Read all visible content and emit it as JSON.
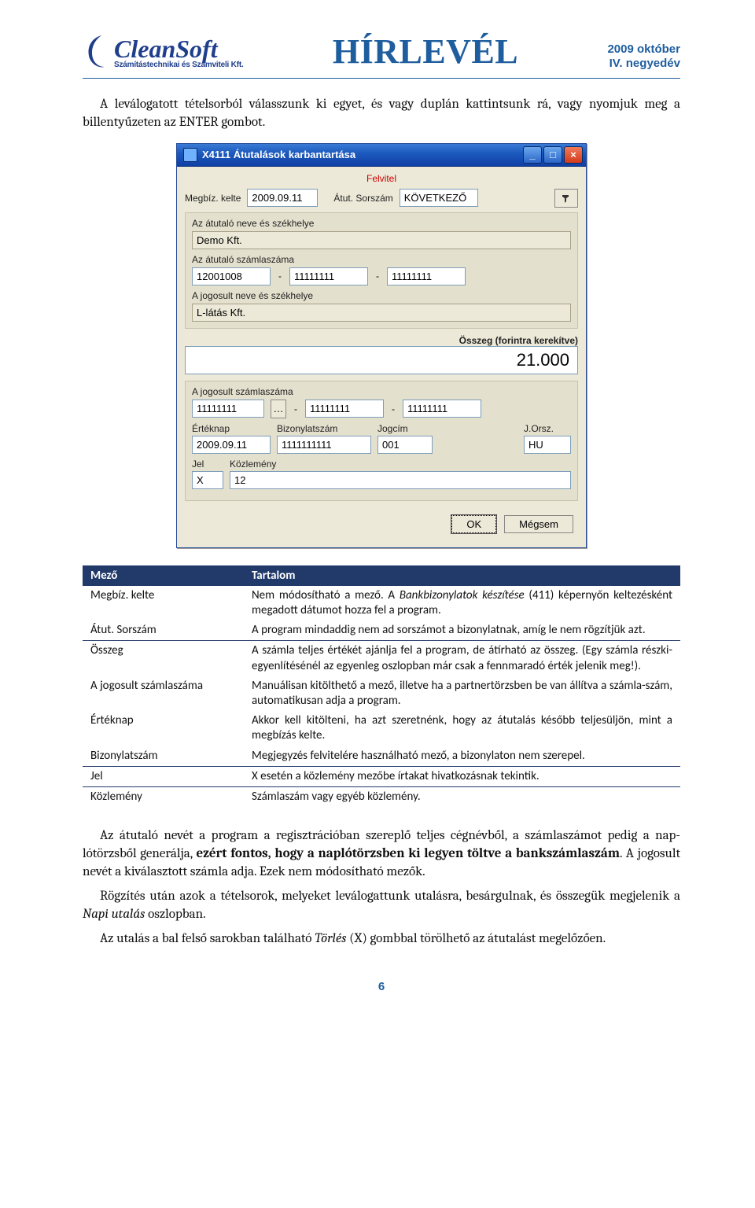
{
  "header": {
    "brand_name": "CleanSoft",
    "brand_sub": "Számítástechnikai és Számviteli Kft.",
    "banner": "HÍRLEVÉL",
    "issue_line1": "2009 október",
    "issue_line2": "IV. negyedév"
  },
  "intro": "A leválogatott tételsorból válasszunk ki egyet, és vagy duplán kattintsunk rá, vagy nyomjuk meg a billentyűzeten az ENTER gombot.",
  "window": {
    "title": "X4111 Átutalások karbantartása",
    "mode": "Felvitel",
    "labels": {
      "megbiz_kelte": "Megbíz. kelte",
      "atut_sorszam": "Átut. Sorszám",
      "atutalo_nev": "Az átutaló neve és székhelye",
      "atutalo_szamla": "Az átutaló számlaszáma",
      "jogosult_nev": "A jogosult neve és székhelye",
      "osszeg": "Összeg (forintra kerekítve)",
      "jogosult_szamla": "A jogosult számlaszáma",
      "erteknap": "Értéknap",
      "bizszam": "Bizonylatszám",
      "jogcim": "Jogcím",
      "jorsz": "J.Orsz.",
      "jel": "Jel",
      "kozlemeny": "Közlemény"
    },
    "values": {
      "megbiz_kelte": "2009.09.11",
      "sorszam": "KÖVETKEZŐ",
      "atutalo_nev": "Demo Kft.",
      "atutalo_szamla": [
        "12001008",
        "11111111",
        "11111111"
      ],
      "jogosult_nev": "L-látás Kft.",
      "osszeg": "21.000",
      "jogosult_szamla": [
        "11111111",
        "11111111",
        "11111111"
      ],
      "erteknap": "2009.09.11",
      "bizszam": "1111111111",
      "jogcim": "001",
      "jorsz": "HU",
      "jel": "X",
      "kozlemeny": "12"
    },
    "buttons": {
      "ok": "OK",
      "cancel": "Mégsem"
    }
  },
  "table": {
    "headers": [
      "Mező",
      "Tartalom"
    ],
    "rows": [
      {
        "field": "Megbíz. kelte",
        "content": "Nem módosítható a mező. A Bankbizonylatok készítése (411) képernyőn keltezésként megadott dátumot hozza fel a program.",
        "italic_span": "Bankbizonylatok készítése"
      },
      {
        "field": "Átut. Sorszám",
        "content": "A program mindaddig nem ad sorszámot a bizonylatnak, amíg le nem rögzítjük azt."
      },
      {
        "field": "Összeg",
        "content": "A számla teljes értékét ajánlja fel a program, de átírható az összeg. (Egy számla részki-egyenlítésénél az egyenleg oszlopban már csak a fennmaradó érték jelenik meg!).",
        "sep": true
      },
      {
        "field": "A jogosult számlaszáma",
        "content": "Manuálisan kitölthető a mező, illetve ha a partnertörzsben be van állítva a számla-szám, automatikusan adja a program."
      },
      {
        "field": "Értéknap",
        "content": "Akkor kell kitölteni, ha azt szeretnénk, hogy az átutalás később teljesüljön, mint a megbízás kelte."
      },
      {
        "field": "Bizonylatszám",
        "content": "Megjegyzés felvitelére használható mező, a bizonylaton nem szerepel."
      },
      {
        "field": "Jel",
        "content": "X esetén a közlemény mezőbe írtakat hivatkozásnak tekintik.",
        "sep": true
      },
      {
        "field": "Közlemény",
        "content": "Számlaszám vagy egyéb közlemény.",
        "sep": true
      }
    ]
  },
  "paragraphs": {
    "p1_a": "Az átutaló nevét a program a regisztrációban szereplő teljes cégnévből, a számlaszámot pedig a nap-lótörzsből generálja, ",
    "p1_bold": "ezért fontos, hogy a naplótörzsben ki legyen töltve a bankszámlaszám",
    "p1_b": ". A jogosult nevét a kiválasztott számla adja. Ezek nem módosítható mezők.",
    "p2_a": "Rögzítés után azok a tételsorok, melyeket leválogattunk utalásra, besárgulnak, és összegük megjelenik a ",
    "p2_it": "Napi utalás",
    "p2_b": " oszlopban.",
    "p3_a": "Az utalás a bal felső sarokban található ",
    "p3_it": "Törlés",
    "p3_b": " (X) gombbal törölhető az átutalást megelőzően."
  },
  "page_number": "6"
}
